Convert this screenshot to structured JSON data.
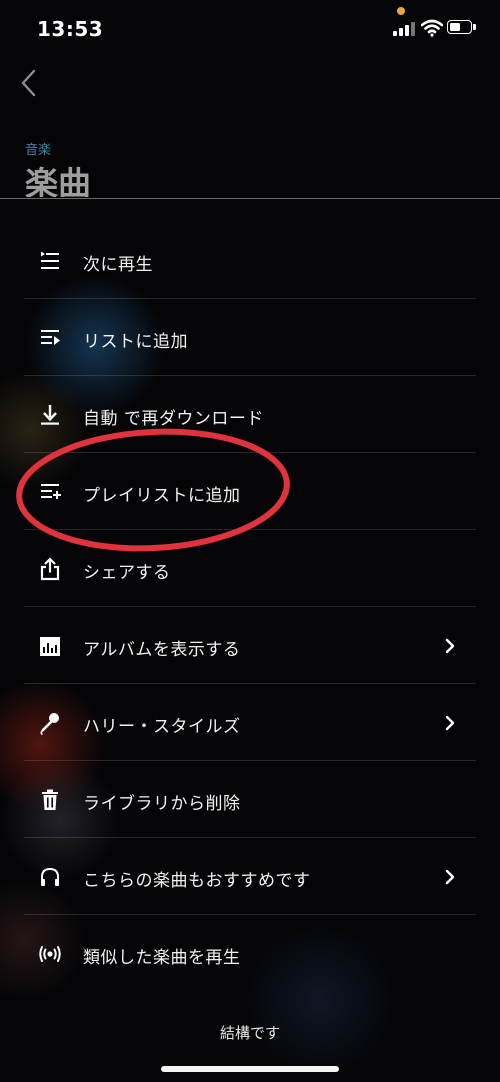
{
  "status_bar": {
    "time": "13:53"
  },
  "header": {
    "section_label": "音楽",
    "title": "楽曲"
  },
  "menu": {
    "items": [
      {
        "label": "次に再生",
        "icon": "play-next-icon",
        "has_chevron": false
      },
      {
        "label": "リストに追加",
        "icon": "add-to-queue-icon",
        "has_chevron": false
      },
      {
        "label": "自動 で再ダウンロード",
        "icon": "download-icon",
        "has_chevron": false
      },
      {
        "label": "プレイリストに追加",
        "icon": "add-to-playlist-icon",
        "has_chevron": false
      },
      {
        "label": "シェアする",
        "icon": "share-icon",
        "has_chevron": false
      },
      {
        "label": "アルバムを表示する",
        "icon": "album-icon",
        "has_chevron": true
      },
      {
        "label": "ハリー・スタイルズ",
        "icon": "microphone-icon",
        "has_chevron": true
      },
      {
        "label": "ライブラリから削除",
        "icon": "trash-icon",
        "has_chevron": false
      },
      {
        "label": "こちらの楽曲もおすすめです",
        "icon": "headphones-icon",
        "has_chevron": true
      },
      {
        "label": "類似した楽曲を再生",
        "icon": "radio-icon",
        "has_chevron": false
      }
    ]
  },
  "footer": {
    "dismiss_label": "結構です"
  },
  "colors": {
    "annotation_ellipse": "#e0333d",
    "section_label": "#3d7fa8",
    "status_dot": "#f2a33a"
  }
}
